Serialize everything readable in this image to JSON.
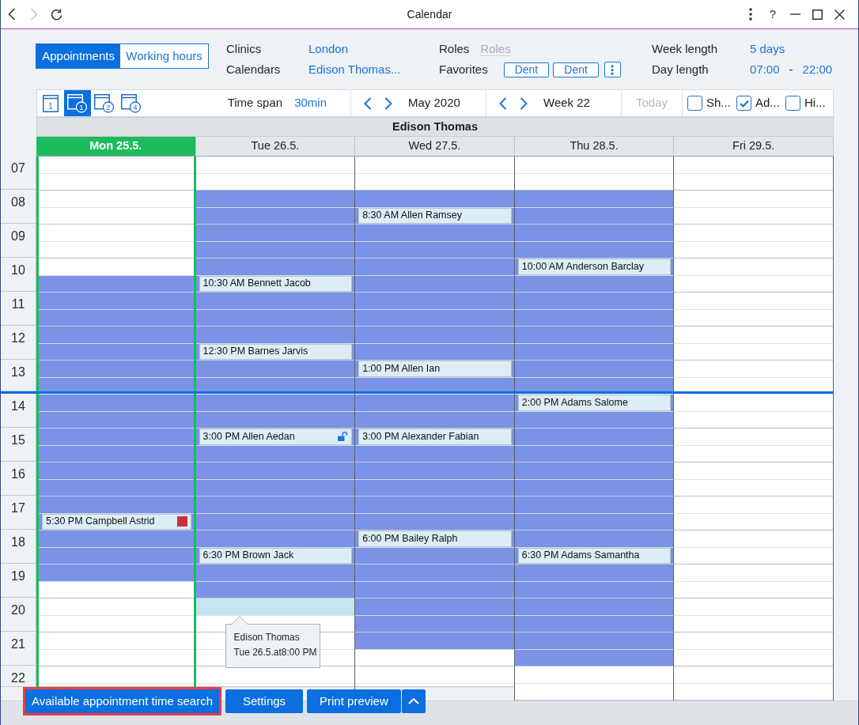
{
  "window": {
    "title": "Calendar",
    "nav": [
      {
        "kind": "back",
        "disabled": false
      },
      {
        "kind": "forward",
        "disabled": true
      },
      {
        "kind": "reload",
        "disabled": false
      }
    ],
    "controls": [
      {
        "kind": "more"
      },
      {
        "kind": "help",
        "label": "?"
      },
      {
        "kind": "minimize"
      },
      {
        "kind": "maximize"
      },
      {
        "kind": "close"
      }
    ]
  },
  "mode_tabs": [
    {
      "label": "Appointments",
      "selected": true
    },
    {
      "label": "Working hours",
      "selected": false
    }
  ],
  "filters": {
    "clinics": {
      "label": "Clinics",
      "value": "London"
    },
    "calendars": {
      "label": "Calendars",
      "value": "Edison Thomas..."
    },
    "roles": {
      "label": "Roles",
      "placeholder": "Roles"
    },
    "favorites": {
      "label": "Favorites",
      "buttons": [
        "Dent",
        "Dent"
      ]
    },
    "week_length": {
      "label": "Week length",
      "value": "5 days"
    },
    "day_length": {
      "label": "Day length",
      "from": "07:00",
      "separator": "-",
      "to": "22:00"
    }
  },
  "toolbar": {
    "views": [
      {
        "kind": "page",
        "label": "1",
        "selected": false
      },
      {
        "kind": "circled",
        "label": "1",
        "selected": true
      },
      {
        "kind": "circled",
        "label": "2",
        "selected": false
      },
      {
        "kind": "circled",
        "label": "4",
        "selected": false
      }
    ],
    "time_span": {
      "label": "Time span",
      "value": "30min"
    },
    "month": "May 2020",
    "week": "Week 22",
    "today": {
      "label": "Today",
      "disabled": true
    },
    "options": [
      {
        "label": "Sh...",
        "checked": false
      },
      {
        "label": "Ad...",
        "checked": true
      },
      {
        "label": "Hi...",
        "checked": false
      }
    ]
  },
  "calendar": {
    "resource": "Edison Thomas",
    "hours": [
      {
        "label": "07",
        "now": false
      },
      {
        "label": "08",
        "now": false
      },
      {
        "label": "09",
        "now": false
      },
      {
        "label": "10",
        "now": false
      },
      {
        "label": "11",
        "now": false
      },
      {
        "label": "12",
        "now": false
      },
      {
        "label": "13",
        "now": true
      },
      {
        "label": "14",
        "now": false
      },
      {
        "label": "15",
        "now": false
      },
      {
        "label": "16",
        "now": false
      },
      {
        "label": "17",
        "now": false
      },
      {
        "label": "18",
        "now": false
      },
      {
        "label": "19",
        "now": false
      },
      {
        "label": "20",
        "now": false
      },
      {
        "label": "21",
        "now": false
      },
      {
        "label": "22",
        "now": false
      }
    ],
    "days": [
      {
        "label": "Mon 25.5.",
        "selected": true,
        "slots": [
          {
            "kind": "off"
          },
          {
            "kind": "off"
          },
          {
            "kind": "off"
          },
          {
            "kind": "off"
          },
          {
            "kind": "off"
          },
          {
            "kind": "off"
          },
          {
            "kind": "off"
          },
          {
            "kind": "work"
          },
          {
            "kind": "work"
          },
          {
            "kind": "work"
          },
          {
            "kind": "work"
          },
          {
            "kind": "work"
          },
          {
            "kind": "work"
          },
          {
            "kind": "work"
          },
          {
            "kind": "work"
          },
          {
            "kind": "work"
          },
          {
            "kind": "work"
          },
          {
            "kind": "work"
          },
          {
            "kind": "work"
          },
          {
            "kind": "work"
          },
          {
            "kind": "work"
          },
          {
            "kind": "work",
            "appointment": {
              "label": "5:30 PM Campbell Astrid",
              "kind": "marked",
              "color": "#c8333b"
            }
          },
          {
            "kind": "work"
          },
          {
            "kind": "work"
          },
          {
            "kind": "work"
          },
          {
            "kind": "off"
          },
          {
            "kind": "off"
          },
          {
            "kind": "off"
          },
          {
            "kind": "off"
          },
          {
            "kind": "off"
          },
          {
            "kind": "off"
          },
          {
            "kind": "off"
          }
        ]
      },
      {
        "label": "Tue 26.5.",
        "selected": false,
        "slots": [
          {
            "kind": "off"
          },
          {
            "kind": "off"
          },
          {
            "kind": "work"
          },
          {
            "kind": "work"
          },
          {
            "kind": "work"
          },
          {
            "kind": "work"
          },
          {
            "kind": "work"
          },
          {
            "kind": "work",
            "appointment": {
              "label": "10:30 AM Bennett Jacob",
              "kind": "plain"
            }
          },
          {
            "kind": "work"
          },
          {
            "kind": "work"
          },
          {
            "kind": "work"
          },
          {
            "kind": "work",
            "appointment": {
              "label": "12:30 PM Barnes Jarvis",
              "kind": "plain"
            }
          },
          {
            "kind": "work"
          },
          {
            "kind": "work"
          },
          {
            "kind": "work"
          },
          {
            "kind": "work"
          },
          {
            "kind": "work",
            "appointment": {
              "label": "3:00 PM Allen Aedan",
              "kind": "unlocked"
            }
          },
          {
            "kind": "work"
          },
          {
            "kind": "work"
          },
          {
            "kind": "work"
          },
          {
            "kind": "work"
          },
          {
            "kind": "work"
          },
          {
            "kind": "work"
          },
          {
            "kind": "work",
            "appointment": {
              "label": "6:30 PM Brown Jack",
              "kind": "plain"
            }
          },
          {
            "kind": "work"
          },
          {
            "kind": "work"
          },
          {
            "kind": "hover",
            "tooltip": [
              "Edison Thomas",
              "Tue 26.5.at8:00 PM"
            ]
          },
          {
            "kind": "off"
          },
          {
            "kind": "off"
          },
          {
            "kind": "off"
          },
          {
            "kind": "off"
          },
          {
            "kind": "off"
          }
        ]
      },
      {
        "label": "Wed 27.5.",
        "selected": false,
        "slots": [
          {
            "kind": "off"
          },
          {
            "kind": "off"
          },
          {
            "kind": "work"
          },
          {
            "kind": "work",
            "appointment": {
              "label": "8:30 AM Allen Ramsey",
              "kind": "plain"
            }
          },
          {
            "kind": "work"
          },
          {
            "kind": "work"
          },
          {
            "kind": "work"
          },
          {
            "kind": "work"
          },
          {
            "kind": "work"
          },
          {
            "kind": "work"
          },
          {
            "kind": "work"
          },
          {
            "kind": "work"
          },
          {
            "kind": "work",
            "appointment": {
              "label": "1:00 PM Allen Ian",
              "kind": "plain"
            }
          },
          {
            "kind": "work"
          },
          {
            "kind": "work"
          },
          {
            "kind": "work"
          },
          {
            "kind": "work",
            "appointment": {
              "label": "3:00 PM Alexander Fabian",
              "kind": "plain"
            }
          },
          {
            "kind": "work"
          },
          {
            "kind": "work"
          },
          {
            "kind": "work"
          },
          {
            "kind": "work"
          },
          {
            "kind": "work"
          },
          {
            "kind": "work",
            "appointment": {
              "label": "6:00 PM Bailey Ralph",
              "kind": "plain"
            }
          },
          {
            "kind": "work"
          },
          {
            "kind": "work"
          },
          {
            "kind": "work"
          },
          {
            "kind": "work"
          },
          {
            "kind": "work"
          },
          {
            "kind": "work"
          },
          {
            "kind": "off"
          },
          {
            "kind": "off"
          },
          {
            "kind": "off"
          }
        ]
      },
      {
        "label": "Thu 28.5.",
        "selected": false,
        "slots": [
          {
            "kind": "off"
          },
          {
            "kind": "off"
          },
          {
            "kind": "work"
          },
          {
            "kind": "work"
          },
          {
            "kind": "work"
          },
          {
            "kind": "work"
          },
          {
            "kind": "work",
            "appointment": {
              "label": "10:00 AM Anderson Barclay",
              "kind": "plain"
            }
          },
          {
            "kind": "work"
          },
          {
            "kind": "work"
          },
          {
            "kind": "work"
          },
          {
            "kind": "work"
          },
          {
            "kind": "work"
          },
          {
            "kind": "work"
          },
          {
            "kind": "work"
          },
          {
            "kind": "work",
            "appointment": {
              "label": "2:00 PM Adams Salome",
              "kind": "plain"
            }
          },
          {
            "kind": "work"
          },
          {
            "kind": "work"
          },
          {
            "kind": "work"
          },
          {
            "kind": "work"
          },
          {
            "kind": "work"
          },
          {
            "kind": "work"
          },
          {
            "kind": "work"
          },
          {
            "kind": "work"
          },
          {
            "kind": "work",
            "appointment": {
              "label": "6:30 PM Adams Samantha",
              "kind": "plain"
            }
          },
          {
            "kind": "work"
          },
          {
            "kind": "work"
          },
          {
            "kind": "work"
          },
          {
            "kind": "work"
          },
          {
            "kind": "work"
          },
          {
            "kind": "work"
          },
          {
            "kind": "off"
          },
          {
            "kind": "off"
          }
        ]
      },
      {
        "label": "Fri 29.5.",
        "selected": false,
        "slots": [
          {
            "kind": "off"
          },
          {
            "kind": "off"
          },
          {
            "kind": "off"
          },
          {
            "kind": "off"
          },
          {
            "kind": "off"
          },
          {
            "kind": "off"
          },
          {
            "kind": "off"
          },
          {
            "kind": "off"
          },
          {
            "kind": "off"
          },
          {
            "kind": "off"
          },
          {
            "kind": "off"
          },
          {
            "kind": "off"
          },
          {
            "kind": "off"
          },
          {
            "kind": "off"
          },
          {
            "kind": "off"
          },
          {
            "kind": "off"
          },
          {
            "kind": "off"
          },
          {
            "kind": "off"
          },
          {
            "kind": "off"
          },
          {
            "kind": "off"
          },
          {
            "kind": "off"
          },
          {
            "kind": "off"
          },
          {
            "kind": "off"
          },
          {
            "kind": "off"
          },
          {
            "kind": "off"
          },
          {
            "kind": "off"
          },
          {
            "kind": "off"
          },
          {
            "kind": "off"
          },
          {
            "kind": "off"
          },
          {
            "kind": "off"
          },
          {
            "kind": "off"
          },
          {
            "kind": "off"
          }
        ]
      }
    ]
  },
  "buttons": [
    {
      "label": "Available appointment time search",
      "highlighted": true,
      "menu": false
    },
    {
      "label": "Settings",
      "highlighted": false,
      "menu": false
    },
    {
      "label": "Print preview",
      "highlighted": false,
      "menu": true
    }
  ]
}
